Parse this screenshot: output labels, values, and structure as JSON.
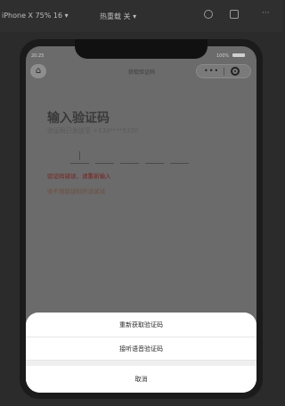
{
  "toolbar": {
    "device_label": "iPhone X 75% 16 ▾",
    "reload_label": "热重载 关 ▾"
  },
  "status": {
    "time": "20:25",
    "battery_text": "100%"
  },
  "nav": {
    "title": "获取验证码"
  },
  "content": {
    "heading": "输入验证码",
    "sent_text": "验证码已发送至 +133****5320",
    "error_text": "验证码错误，请重新输入",
    "no_code_text": "收不到验证码的话试试"
  },
  "action_sheet": {
    "resend_label": "重新获取验证码",
    "voice_label": "接听语音验证码",
    "cancel_label": "取消"
  },
  "icons": {
    "home": "home-icon",
    "more": "more-dots-icon",
    "target": "target-icon"
  }
}
